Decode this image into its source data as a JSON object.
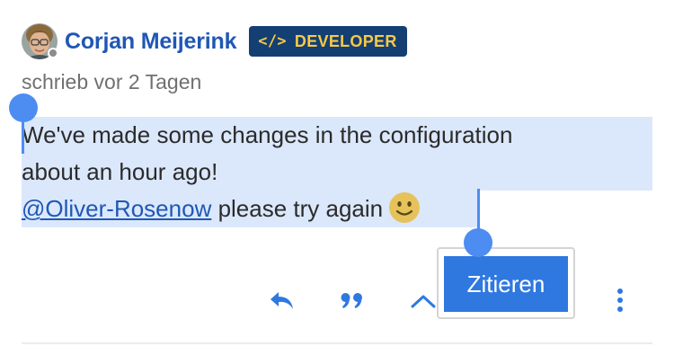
{
  "author": {
    "name": "Corjan Meijerink",
    "badge_icon": "</>",
    "badge_label": "DEVELOPER",
    "presence": "offline"
  },
  "post": {
    "meta": "schrieb vor 2 Tagen",
    "line1": "We've made some changes in the configuration",
    "line2": "about an hour ago!",
    "mention": "@Oliver-Rosenow",
    "line3_rest": " please try again",
    "emoji": "slightly-smiling-face"
  },
  "selection_popup": {
    "quote_label": "Zitieren"
  },
  "actions": {
    "reply_icon": "reply-icon",
    "quote_icon": "quote-icon",
    "collapse_icon": "chevron-up-icon",
    "more_icon": "more-vertical-icon"
  },
  "colors": {
    "accent": "#2f78e0",
    "username": "#1f57b5",
    "badge_bg": "#143f73",
    "badge_text": "#f7c948",
    "selection": "#dbe8fb",
    "handle": "#4d8df2"
  }
}
